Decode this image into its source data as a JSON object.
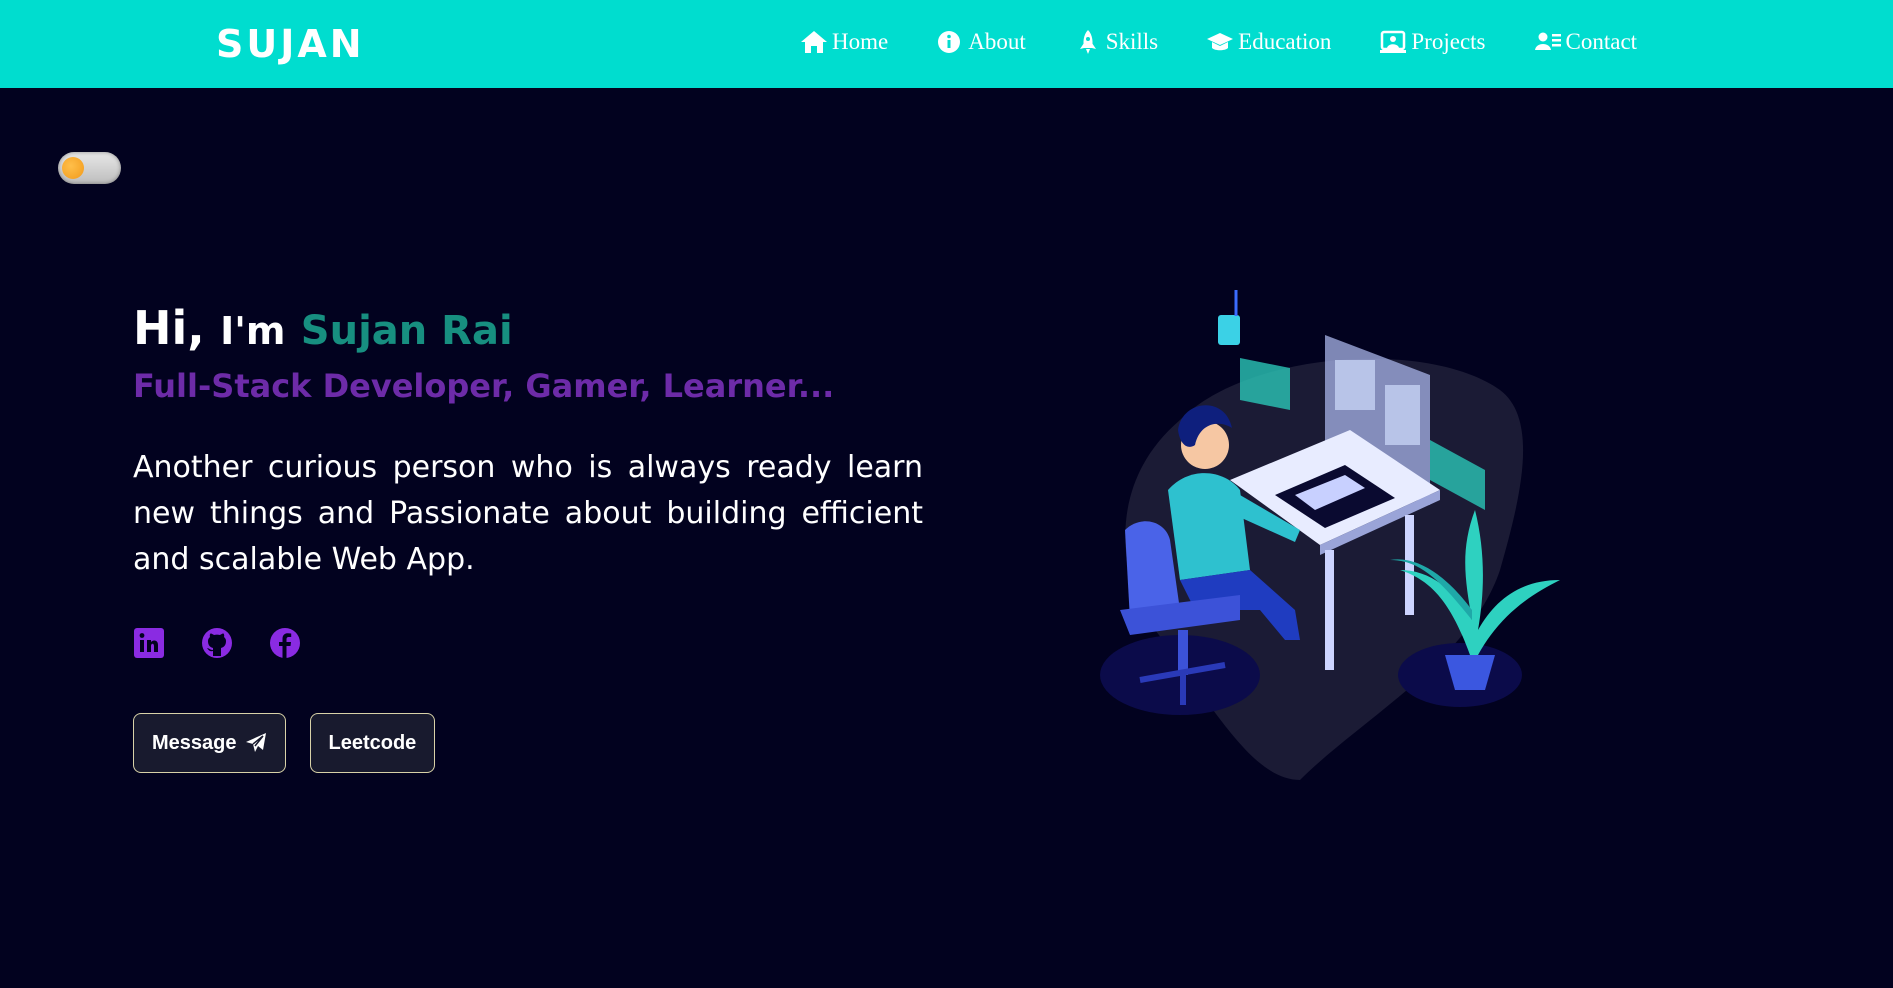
{
  "brand": "SUJAN",
  "nav": [
    {
      "label": "Home",
      "icon": "home-icon"
    },
    {
      "label": "About",
      "icon": "info-icon"
    },
    {
      "label": "Skills",
      "icon": "rocket-icon"
    },
    {
      "label": "Education",
      "icon": "graduation-cap-icon"
    },
    {
      "label": "Projects",
      "icon": "laptop-user-icon"
    },
    {
      "label": "Contact",
      "icon": "contact-card-icon"
    }
  ],
  "hero": {
    "hi": "Hi,",
    "im": "I'm",
    "name": "Sujan Rai",
    "tagline": "Full-Stack Developer, Gamer, Learner...",
    "bio": "Another curious person who is always ready learn new things and Passionate about building efficient and scalable Web App."
  },
  "social": [
    "linkedin-icon",
    "github-icon",
    "facebook-icon"
  ],
  "buttons": {
    "message": "Message",
    "leetcode": "Leetcode"
  },
  "colors": {
    "navbar": "#00ddcf",
    "background": "#02021f",
    "name": "#178f80",
    "tagline": "#6d2ba8",
    "social": "#8a2be2"
  }
}
